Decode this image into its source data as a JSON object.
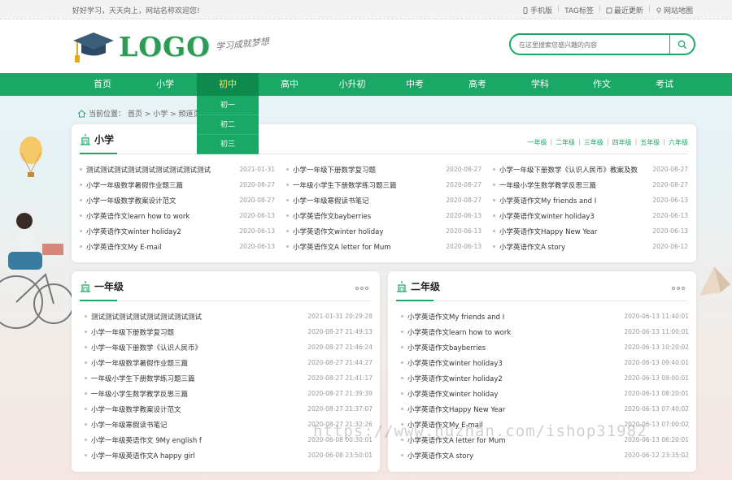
{
  "topbar": {
    "welcome": "好好学习，天天向上，网站名称欢迎您!",
    "links": [
      "手机版",
      "TAG标签",
      "最近更新",
      "网站地图"
    ]
  },
  "header": {
    "logo_text": "LOGO",
    "slogan": "学习成就梦想",
    "search_placeholder": "在这里搜索您感兴趣的内容"
  },
  "nav": {
    "items": [
      "首页",
      "小学",
      "初中",
      "高中",
      "小升初",
      "中考",
      "高考",
      "学科",
      "作文",
      "考试"
    ],
    "active": "初中",
    "dropdown": [
      "初一",
      "初二",
      "初三"
    ]
  },
  "breadcrumb": {
    "label": "当前位置：",
    "path": "首页 > 小学 > 频道页"
  },
  "main_panel": {
    "title": "小学",
    "grades": [
      "一年级",
      "二年级",
      "三年级",
      "四年级",
      "五年级",
      "六年级"
    ],
    "columns": [
      [
        {
          "title": "测试测试测试测试测试测试测试测试测试",
          "date": "2021-01-31"
        },
        {
          "title": "小学一年级数学暑假作业题三篇",
          "date": "2020-08-27"
        },
        {
          "title": "小学一年级数学教案设计范文",
          "date": "2020-08-27"
        },
        {
          "title": "小学英语作文learn how to work",
          "date": "2020-06-13"
        },
        {
          "title": "小学英语作文winter holiday2",
          "date": "2020-06-13"
        },
        {
          "title": "小学英语作文My E-mail",
          "date": "2020-06-13"
        }
      ],
      [
        {
          "title": "小学一年级下册数学复习题",
          "date": "2020-08-27"
        },
        {
          "title": "一年级小学生下册数学练习题三篇",
          "date": "2020-08-27"
        },
        {
          "title": "小学一年级寒假读书笔记",
          "date": "2020-08-27"
        },
        {
          "title": "小学英语作文bayberries",
          "date": "2020-06-13"
        },
        {
          "title": "小学英语作文winter holiday",
          "date": "2020-06-13"
        },
        {
          "title": "小学英语作文A letter for Mum",
          "date": "2020-06-13"
        }
      ],
      [
        {
          "title": "小学一年级下册数学《认识人民币》教案及数",
          "date": "2020-08-27"
        },
        {
          "title": "一年级小学生数学教学反思三篇",
          "date": "2020-08-27"
        },
        {
          "title": "小学英语作文My friends and I",
          "date": "2020-06-13"
        },
        {
          "title": "小学英语作文winter holiday3",
          "date": "2020-06-13"
        },
        {
          "title": "小学英语作文Happy New Year",
          "date": "2020-06-13"
        },
        {
          "title": "小学英语作文A story",
          "date": "2020-06-12"
        }
      ]
    ]
  },
  "grade1_panel": {
    "title": "一年级",
    "items": [
      {
        "title": "测试测试测试测试测试测试测试测试",
        "date": "2021-01-31 20:29:28"
      },
      {
        "title": "小学一年级下册数学复习题",
        "date": "2020-08-27 21:49:13"
      },
      {
        "title": "小学一年级下册数学《认识人民币》",
        "date": "2020-08-27 21:46:24"
      },
      {
        "title": "小学一年级数学暑假作业题三篇",
        "date": "2020-08-27 21:44:27"
      },
      {
        "title": "一年级小学生下册数学练习题三篇",
        "date": "2020-08-27 21:41:17"
      },
      {
        "title": "一年级小学生数学教学反思三篇",
        "date": "2020-08-27 21:39:39"
      },
      {
        "title": "小学一年级数学教案设计范文",
        "date": "2020-08-27 21:37:07"
      },
      {
        "title": "小学一年级寒假读书笔记",
        "date": "2020-08-27 21:32:26"
      },
      {
        "title": "小学一年级英语作文 9My english f",
        "date": "2020-06-08 00:30:01"
      },
      {
        "title": "小学一年级英语作文A happy girl",
        "date": "2020-06-08 23:50:01"
      }
    ]
  },
  "grade2_panel": {
    "title": "二年级",
    "items": [
      {
        "title": "小学英语作文My friends and I",
        "date": "2020-06-13 11:40:01"
      },
      {
        "title": "小学英语作文learn how to work",
        "date": "2020-06-13 11:00:01"
      },
      {
        "title": "小学英语作文bayberries",
        "date": "2020-06-13 10:20:02"
      },
      {
        "title": "小学英语作文winter holiday3",
        "date": "2020-06-13 09:40:01"
      },
      {
        "title": "小学英语作文winter holiday2",
        "date": "2020-06-13 09:00:01"
      },
      {
        "title": "小学英语作文winter holiday",
        "date": "2020-06-13 08:20:01"
      },
      {
        "title": "小学英语作文Happy New Year",
        "date": "2020-06-13 07:40:02"
      },
      {
        "title": "小学英语作文My E-mail",
        "date": "2020-06-13 07:00:02"
      },
      {
        "title": "小学英语作文A letter for Mum",
        "date": "2020-06-13 06:20:01"
      },
      {
        "title": "小学英语作文A story",
        "date": "2020-06-12 23:35:02"
      }
    ]
  },
  "watermark": "https://www.huzhan.com/ishop31982",
  "colors": {
    "brand": "#1aa866",
    "brand_dark": "#0f8a4f",
    "active_text": "#ffe35a"
  }
}
